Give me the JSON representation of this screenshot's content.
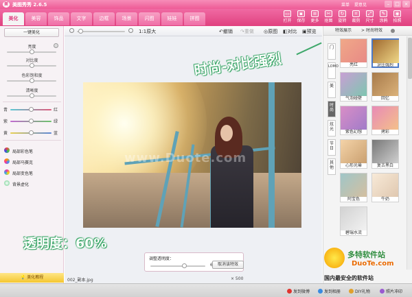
{
  "app": {
    "title": "美图秀秀 2.6.5",
    "menu_items": [
      "菜单",
      "提意见"
    ]
  },
  "tabs": [
    "美化",
    "美容",
    "饰品",
    "文字",
    "边框",
    "场景",
    "闪图",
    "娃娃",
    "拼图"
  ],
  "toolbar": [
    {
      "label": "打开",
      "icon": "folder-icon"
    },
    {
      "label": "保存",
      "icon": "save-icon"
    },
    {
      "label": "更多",
      "icon": "more-icon"
    },
    {
      "label": "抠图",
      "icon": "cutout-icon"
    },
    {
      "label": "旋转",
      "icon": "rotate-icon"
    },
    {
      "label": "裁剪",
      "icon": "crop-icon"
    },
    {
      "label": "尺寸",
      "icon": "resize-icon"
    },
    {
      "label": "涂鸦",
      "icon": "doodle-icon"
    },
    {
      "label": "拍照",
      "icon": "camera-icon"
    }
  ],
  "left": {
    "one_click": "一键美化",
    "brightness": "亮度",
    "contrast": "对比度",
    "saturation": "色彩饱和度",
    "sharpness": "清晰度",
    "color_rows": [
      {
        "left": "青",
        "right": "红"
      },
      {
        "left": "紫",
        "right": "绿"
      },
      {
        "left": "黄",
        "right": "蓝"
      }
    ],
    "tools": [
      "局部彩色笔",
      "局部马赛克",
      "局部变色笔",
      "背景虚化"
    ],
    "tutorial": "美化教程"
  },
  "canvas": {
    "zoom": "1:1原大",
    "undo": "撤销",
    "redo": "重做",
    "original": "原图",
    "compare": "对比",
    "preview": "预览",
    "filename": "002_副本.jpg",
    "size": "× 500",
    "watermark": "www.Duote.com"
  },
  "alpha": {
    "label": "调整透明度：",
    "value": "60%",
    "cancel": "取消该特效"
  },
  "annotations": {
    "top": "时尚-对比强烈",
    "bottom": "透明度：60%"
  },
  "right": {
    "breadcrumb_a": "特效展示",
    "breadcrumb_b": "时尚特效",
    "vtabs": [
      "门",
      "LOMO",
      "美",
      "时尚",
      "炫光",
      "节日",
      "其他"
    ],
    "effects": [
      {
        "name": "亮红",
        "colors": [
          "#f0a888",
          "#e88a86"
        ]
      },
      {
        "name": "对比强烈",
        "colors": [
          "#a06a30",
          "#f0d888"
        ]
      },
      {
        "name": "气泡碰壁",
        "colors": [
          "#c89fd4",
          "#7ec6b0"
        ]
      },
      {
        "name": "回忆",
        "colors": [
          "#a77a4a",
          "#dbb27a"
        ]
      },
      {
        "name": "紫色幻想",
        "colors": [
          "#d98ec6",
          "#a17cc9"
        ]
      },
      {
        "name": "拷彩",
        "colors": [
          "#e88ab6",
          "#f4c08a"
        ]
      },
      {
        "name": "心形光晕",
        "colors": [
          "#f4d3a8",
          "#caa070"
        ]
      },
      {
        "name": "复古黑白",
        "colors": [
          "#777777",
          "#cfcfcf"
        ]
      },
      {
        "name": "阿宝色",
        "colors": [
          "#9fc6c8",
          "#d4bfa0"
        ]
      },
      {
        "name": "牛奶",
        "colors": [
          "#f8ead8",
          "#e0c8b0"
        ]
      },
      {
        "name": "碧瑞水流",
        "colors": [
          "#d2d2d2",
          "#f2f2f2"
        ]
      }
    ]
  },
  "site_logo": {
    "name": "多特软件站",
    "domain": "DuoTe.com",
    "slogan": "国内最安全的软件站"
  },
  "footer": [
    "发到微博",
    "发到相册",
    "DIY礼物",
    "照片冲印"
  ]
}
